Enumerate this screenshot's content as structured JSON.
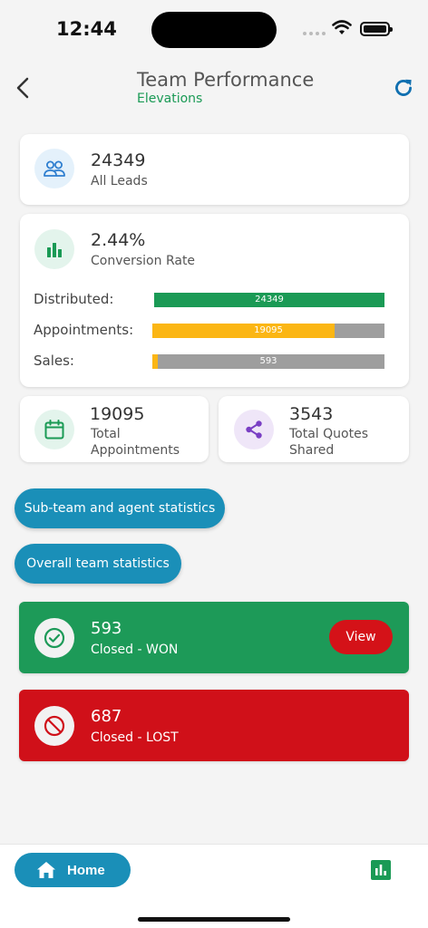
{
  "status_bar": {
    "time": "12:44"
  },
  "header": {
    "title": "Team Performance",
    "subtitle": "Elevations"
  },
  "leads": {
    "value": "24349",
    "label": "All Leads"
  },
  "conversion": {
    "value": "2.44%",
    "label": "Conversion Rate",
    "bars": [
      {
        "label": "Distributed:",
        "value": "24349",
        "fraction": 1.0,
        "color": "#1a9a55"
      },
      {
        "label": "Appointments:",
        "value": "19095",
        "fraction": 0.784,
        "color": "#fbb614"
      },
      {
        "label": "Sales:",
        "value": "593",
        "fraction": 0.024,
        "color": "#fbb614"
      }
    ]
  },
  "appointments": {
    "value": "19095",
    "label": "Total Appointments"
  },
  "quotes": {
    "value": "3543",
    "label": "Total Quotes Shared"
  },
  "buttons": {
    "subteam": "Sub-team and agent statistics",
    "overall": "Overall team statistics"
  },
  "won": {
    "value": "593",
    "label": "Closed - WON",
    "view_label": "View",
    "color": "#1d9a58"
  },
  "lost": {
    "value": "687",
    "label": "Closed - LOST",
    "color": "#d01019"
  },
  "nav": {
    "home_label": "Home"
  },
  "colors": {
    "accent": "#1a8fb8",
    "green": "#1a9a55",
    "red": "#d41218",
    "bar_track": "#9e9e9e"
  }
}
